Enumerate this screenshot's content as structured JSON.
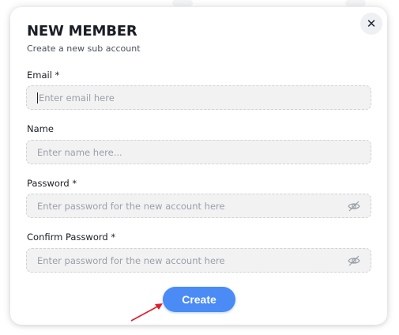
{
  "modal": {
    "title": "NEW MEMBER",
    "subtitle": "Create a new sub account",
    "close_icon": "close-icon"
  },
  "fields": {
    "email": {
      "label": "Email *",
      "placeholder": "Enter email here",
      "value": ""
    },
    "name": {
      "label": "Name",
      "placeholder": "Enter name here...",
      "value": ""
    },
    "password": {
      "label": "Password *",
      "placeholder": "Enter password for the new account here",
      "value": "",
      "icon": "eye-slash-icon"
    },
    "confirm_password": {
      "label": "Confirm Password *",
      "placeholder": "Enter password for the new account here",
      "value": "",
      "icon": "eye-slash-icon"
    }
  },
  "actions": {
    "create_label": "Create"
  },
  "colors": {
    "accent": "#4a8bf5",
    "annotation_arrow": "#e11d2a"
  }
}
